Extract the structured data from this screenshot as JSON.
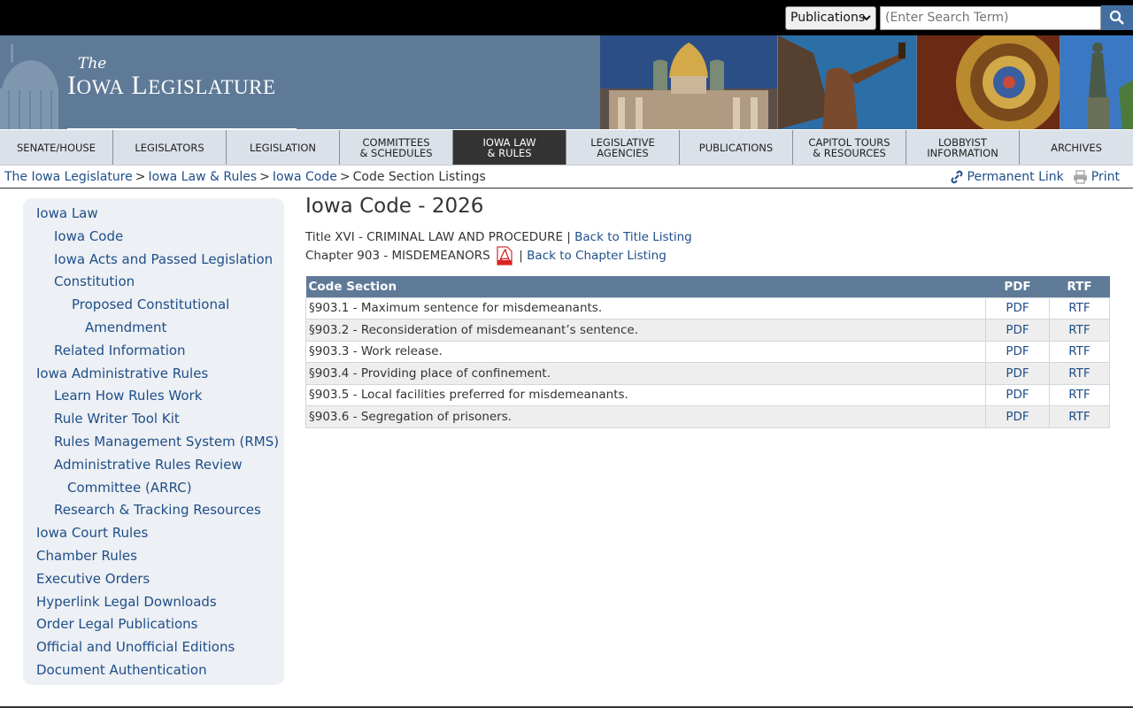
{
  "search": {
    "select_value": "Publications",
    "placeholder": "(Enter Search Term)"
  },
  "brand": {
    "the": "The",
    "name_cap1": "I",
    "name_rest1": "OWA",
    "name_cap2": "L",
    "name_rest2": "EGISLATURE"
  },
  "nav": [
    {
      "label": "Senate/House"
    },
    {
      "label": "Legislators"
    },
    {
      "label": "Legislation"
    },
    {
      "label": "Committees\n& Schedules"
    },
    {
      "label": "Iowa Law\n& Rules"
    },
    {
      "label": "Legislative\nAgencies"
    },
    {
      "label": "Publications"
    },
    {
      "label": "Capitol Tours\n& Resources"
    },
    {
      "label": "Lobbyist\nInformation"
    },
    {
      "label": "Archives"
    }
  ],
  "breadcrumb": [
    "The Iowa Legislature",
    "Iowa Law & Rules",
    "Iowa Code",
    "Code Section Listings"
  ],
  "breadcrumb_sep": ">",
  "tools": {
    "permalink": "Permanent Link",
    "print": "Print"
  },
  "sidebar": [
    {
      "label": "Iowa Law"
    },
    {
      "label": "Iowa Code"
    },
    {
      "label": "Iowa Acts and Passed Legislation"
    },
    {
      "label": "Constitution"
    },
    {
      "label": "Proposed Constitutional"
    },
    {
      "label": "Amendment"
    },
    {
      "label": "Related Information"
    },
    {
      "label": "Iowa Administrative Rules"
    },
    {
      "label": "Learn How Rules Work"
    },
    {
      "label": "Rule Writer Tool Kit"
    },
    {
      "label": "Rules Management System (RMS)"
    },
    {
      "label": "Administrative Rules Review"
    },
    {
      "label": "Committee (ARRC)"
    },
    {
      "label": "Research & Tracking Resources"
    },
    {
      "label": "Iowa Court Rules"
    },
    {
      "label": "Chamber Rules"
    },
    {
      "label": "Executive Orders"
    },
    {
      "label": "Hyperlink Legal Downloads"
    },
    {
      "label": "Order Legal Publications"
    },
    {
      "label": "Official and Unofficial Editions"
    },
    {
      "label": "Document Authentication"
    }
  ],
  "main": {
    "title": "Iowa Code - 2026",
    "title_line": "Title XVI - CRIMINAL LAW AND PROCEDURE",
    "back_title": "Back to Title Listing",
    "chapter_line": "Chapter 903 - MISDEMEANORS",
    "back_chapter": "Back to Chapter Listing",
    "pipe": "|"
  },
  "table": {
    "headers": [
      "Code Section",
      "PDF",
      "RTF"
    ],
    "rows": [
      {
        "section": "§903.1 - Maximum sentence for misdemeanants.",
        "pdf": "PDF",
        "rtf": "RTF"
      },
      {
        "section": "§903.2 - Reconsideration of misdemeanant’s sentence.",
        "pdf": "PDF",
        "rtf": "RTF"
      },
      {
        "section": "§903.3 - Work release.",
        "pdf": "PDF",
        "rtf": "RTF"
      },
      {
        "section": "§903.4 - Providing place of confinement.",
        "pdf": "PDF",
        "rtf": "RTF"
      },
      {
        "section": "§903.5 - Local facilities preferred for misdemeanants.",
        "pdf": "PDF",
        "rtf": "RTF"
      },
      {
        "section": "§903.6 - Segregation of prisoners.",
        "pdf": "PDF",
        "rtf": "RTF"
      }
    ]
  },
  "colors": {
    "nav_active": "#333333",
    "banner": "#5f7a97",
    "link": "#1f4e89",
    "table_header": "#5f7a97"
  }
}
